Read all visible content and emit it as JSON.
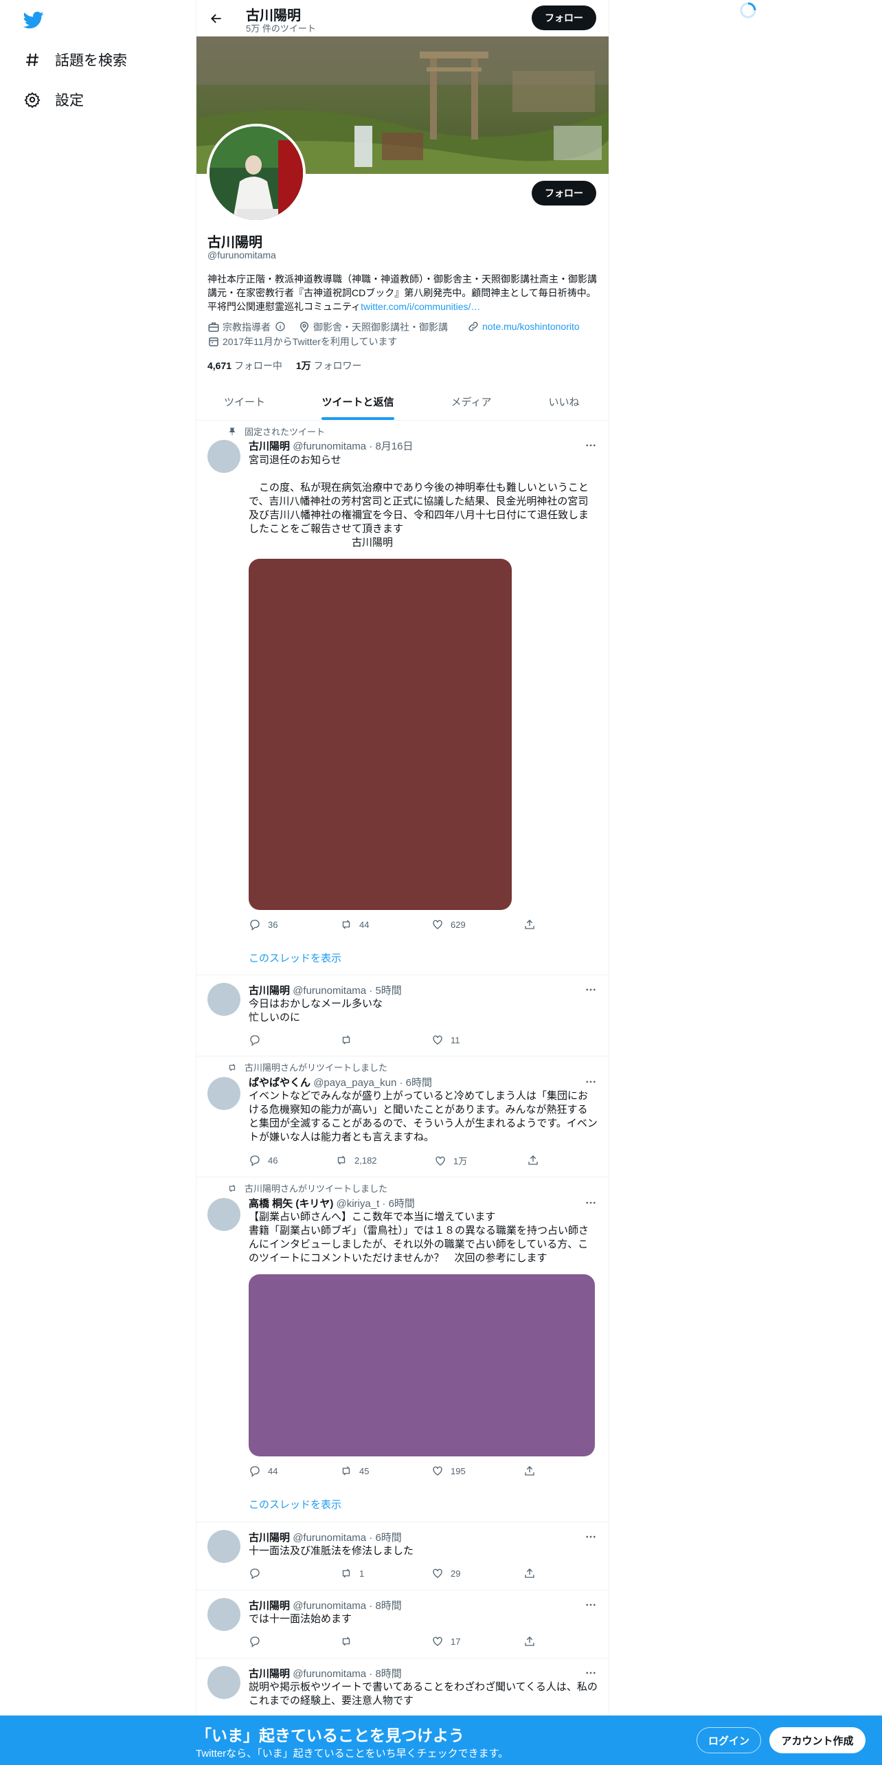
{
  "sidebar": {
    "items": [
      {
        "icon": "hashtag-icon",
        "label": "話題を検索"
      },
      {
        "icon": "gear-icon",
        "label": "設定"
      }
    ]
  },
  "header": {
    "name": "古川陽明",
    "tweet_count": "5万 件のツイート",
    "follow_label": "フォロー"
  },
  "profile": {
    "name": "古川陽明",
    "handle": "@furunomitama",
    "follow_label": "フォロー",
    "bio": "神社本庁正階・教派神道教導職（神職・神道教師）・御影舎主・天照御影講社斎主・御影講講元・在家密教行者『古神道祝詞CDブック』第八刷発売中。顧問神主として毎日祈祷中。平将門公関連慰霊巡礼コミュニティ",
    "bio_link": "twitter.com/i/communities/…",
    "category": "宗教指導者",
    "location": "御影舎・天照御影講社・御影講",
    "website": "note.mu/koshintonorito",
    "joined": "2017年11月からTwitterを利用しています",
    "following_count": "4,671",
    "following_label": "フォロー中",
    "followers_count": "1万",
    "followers_label": "フォロワー"
  },
  "tabs": [
    "ツイート",
    "ツイートと返信",
    "メディア",
    "いいね"
  ],
  "active_tab": "ツイートと返信",
  "tweets": [
    {
      "social": "固定されたツイート",
      "name": "古川陽明",
      "meta": "@furunomitama · 8月16日",
      "text": "宮司退任のお知らせ\n\n　この度、私が現在病気治療中であり今後の神明奉仕も難しいということで、吉川八幡神社の芳村宮司と正式に協議した結果、艮金光明神社の宮司及び吉川八幡神社の権禰宜を今日、令和四年八月十七日付にて退任致しましたことをご報告させて頂きます\n　　　　　　　　　　古川陽明",
      "media_color": "#763737",
      "reply": "36",
      "retweet": "44",
      "like": "629",
      "thread": "このスレッドを表示"
    },
    {
      "social": "",
      "name": "古川陽明",
      "meta": "@furunomitama · 5時間",
      "text": "今日はおかしなメール多いな\n忙しいのに",
      "reply": "",
      "retweet": "",
      "like": "11"
    },
    {
      "social": "古川陽明さんがリツイートしました",
      "name": "ぱやぱやくん",
      "meta": "@paya_paya_kun · 6時間",
      "text": "イベントなどでみんなが盛り上がっていると冷めてしまう人は「集団における危機察知の能力が高い」と聞いたことがあります。みんなが熱狂すると集団が全滅することがあるので、そういう人が生まれるようです。イベントが嫌いな人は能力者とも言えますね。",
      "reply": "46",
      "retweet": "2,182",
      "like": "1万"
    },
    {
      "social": "古川陽明さんがリツイートしました",
      "name": "高橋 桐矢 (キリヤ)",
      "meta": "@kiriya_t · 6時間",
      "text": "【副業占い師さんへ】ここ数年で本当に増えています\n書籍「副業占い師ブギ」（雷鳥社）」では１８の異なる職業を持つ占い師さんにインタビューしましたが、それ以外の職業で占い師をしている方、このツイートにコメントいただけませんか？　次回の参考にします",
      "media_color": "#835a91",
      "reply": "44",
      "retweet": "45",
      "like": "195",
      "thread": "このスレッドを表示"
    },
    {
      "social": "",
      "name": "古川陽明",
      "meta": "@furunomitama · 6時間",
      "text": "十一面法及び准胝法を修法しました",
      "reply": "",
      "retweet": "1",
      "like": "29"
    },
    {
      "social": "",
      "name": "古川陽明",
      "meta": "@furunomitama · 8時間",
      "text": "では十一面法始めます",
      "reply": "",
      "retweet": "",
      "like": "17"
    },
    {
      "social": "",
      "name": "古川陽明",
      "meta": "@furunomitama · 8時間",
      "text": "説明や掲示板やツイートで書いてあることをわざわざ聞いてくる人は、私のこれまでの経験上、要注意人物です"
    }
  ],
  "bottom_bar": {
    "title": "「いま」起きていることを見つけよう",
    "subtitle": "Twitterなら、「いま」起きていることをいち早くチェックできます。",
    "login_label": "ログイン",
    "signup_label": "アカウント作成"
  },
  "colors": {
    "accent": "#1d9bf0",
    "text_primary": "#0f1419",
    "text_secondary": "#536471",
    "avatar_placeholder": "#bccbd6"
  }
}
